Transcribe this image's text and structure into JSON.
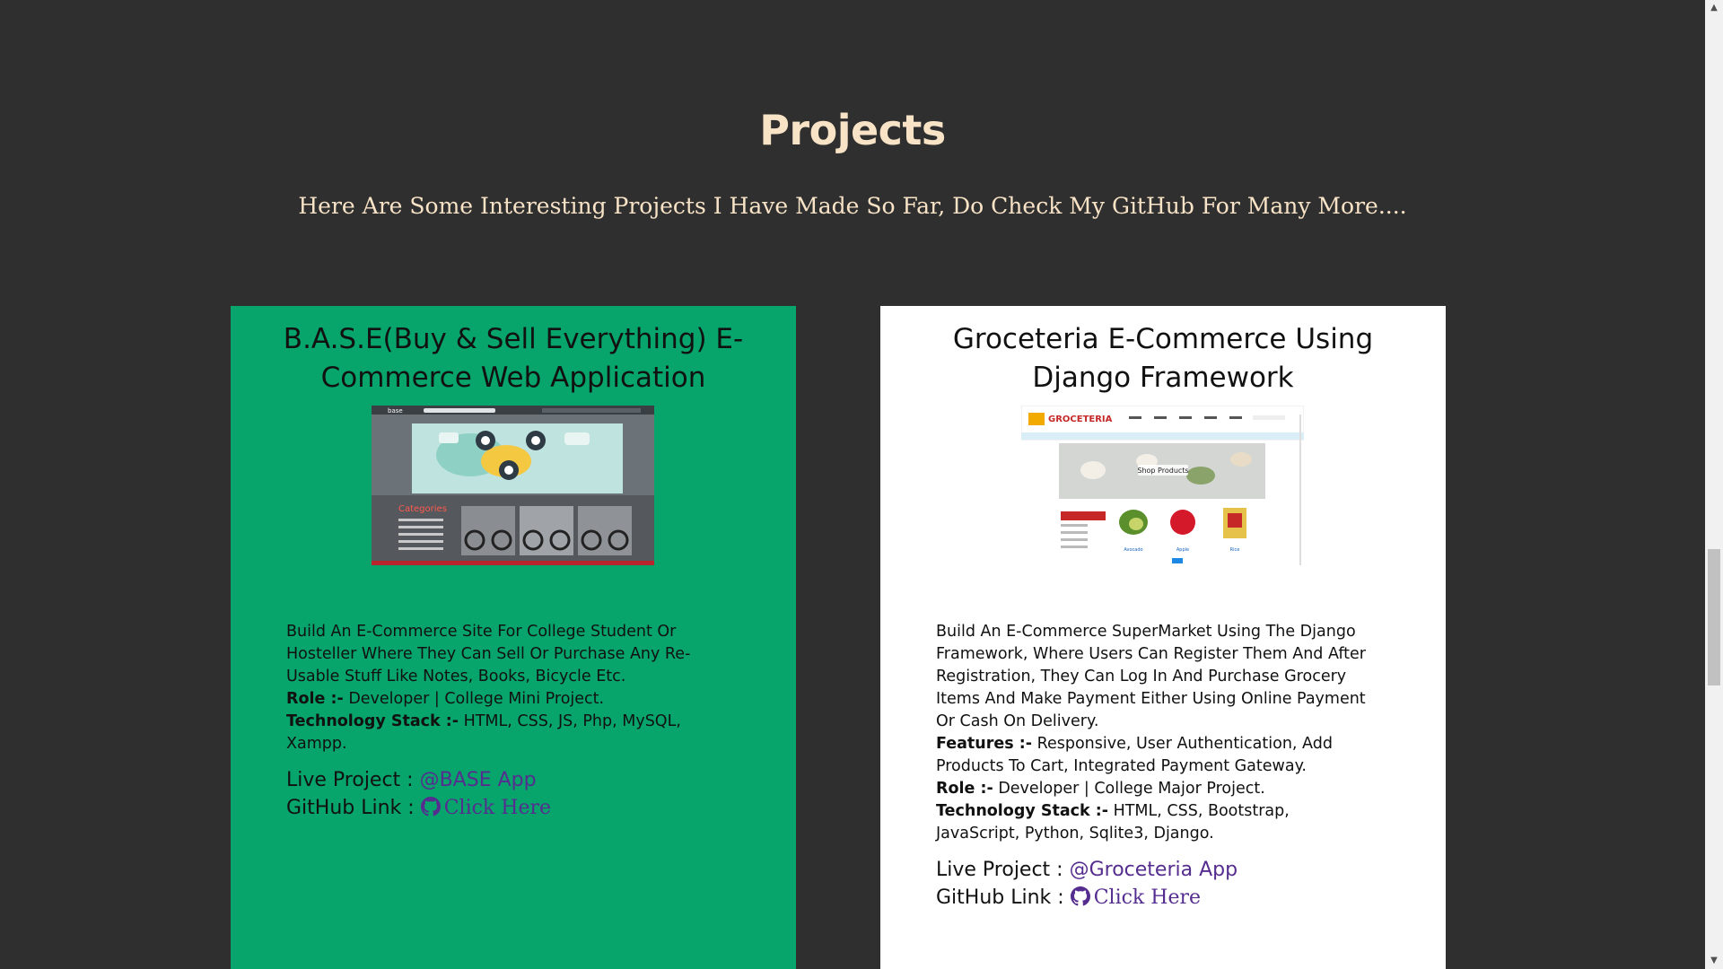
{
  "section": {
    "title": "Projects",
    "subtitle": "Here Are Some Interesting Projects I Have Made So Far, Do Check My GitHub For Many More...."
  },
  "projects": [
    {
      "title": "B.A.S.E(Buy & Sell Everything) E-Commerce Web Application",
      "description": "Build An E-Commerce Site For College Student Or Hosteller Where They Can Sell Or Purchase Any Re-Usable Stuff Like Notes, Books, Bicycle Etc.",
      "role_label": "Role :-",
      "role": "Developer | College Mini Project.",
      "stack_label": "Technology Stack :-",
      "stack": "HTML, CSS, JS, Php, MySQL, Xampp.",
      "live_label": "Live Project :",
      "live_link": "@BASE App",
      "github_label": "GitHub Link :",
      "github_link": "Click Here",
      "background": "#07a56b",
      "thumb": {
        "brand": "base",
        "heading": "Categories"
      }
    },
    {
      "title": "Groceteria E-Commerce Using Django Framework",
      "description": "Build An E-Commerce SuperMarket Using The Django Framework, Where Users Can Register Them And After Registration, They Can Log In And Purchase Grocery Items And Make Payment Either Using Online Payment Or Cash On Delivery.",
      "features_label": "Features :-",
      "features": "Responsive, User Authentication, Add Products To Cart, Integrated Payment Gateway.",
      "role_label": "Role :-",
      "role": "Developer | College Major Project.",
      "stack_label": "Technology Stack :-",
      "stack": "HTML, CSS, Bootstrap, JavaScript, Python, Sqlite3, Django.",
      "live_label": "Live Project :",
      "live_link": "@Groceteria App",
      "github_label": "GitHub Link :",
      "github_link": "Click Here",
      "background": "#ffffff",
      "thumb": {
        "brand": "GROCETERIA",
        "banner": "Shop Products",
        "products": [
          "Avocado",
          "Apple",
          "Rice"
        ]
      }
    }
  ],
  "colors": {
    "page_bg": "#2f2f2f",
    "heading": "#f8e3c7",
    "link": "#552d8f"
  },
  "icons": [
    "github-icon"
  ]
}
